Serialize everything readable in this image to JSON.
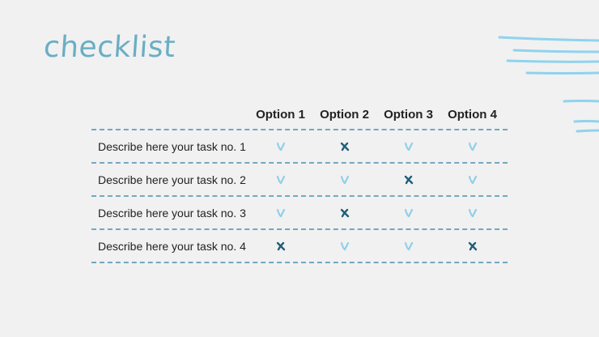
{
  "title": "checklist",
  "options": [
    "Option 1",
    "Option 2",
    "Option 3",
    "Option 4"
  ],
  "rows": [
    {
      "task": "Describe here your task no. 1",
      "marks": [
        "check",
        "cross",
        "check",
        "check"
      ]
    },
    {
      "task": "Describe here your task no. 2",
      "marks": [
        "check",
        "check",
        "cross",
        "check"
      ]
    },
    {
      "task": "Describe here your task no. 3",
      "marks": [
        "check",
        "cross",
        "check",
        "check"
      ]
    },
    {
      "task": "Describe here your task no. 4",
      "marks": [
        "cross",
        "check",
        "check",
        "cross"
      ]
    }
  ],
  "colors": {
    "check": "#8fcfea",
    "cross": "#1f5f7a",
    "title": "#6aaec4",
    "dashes": "#74a7bf",
    "decoration": "#8fd3ee"
  }
}
